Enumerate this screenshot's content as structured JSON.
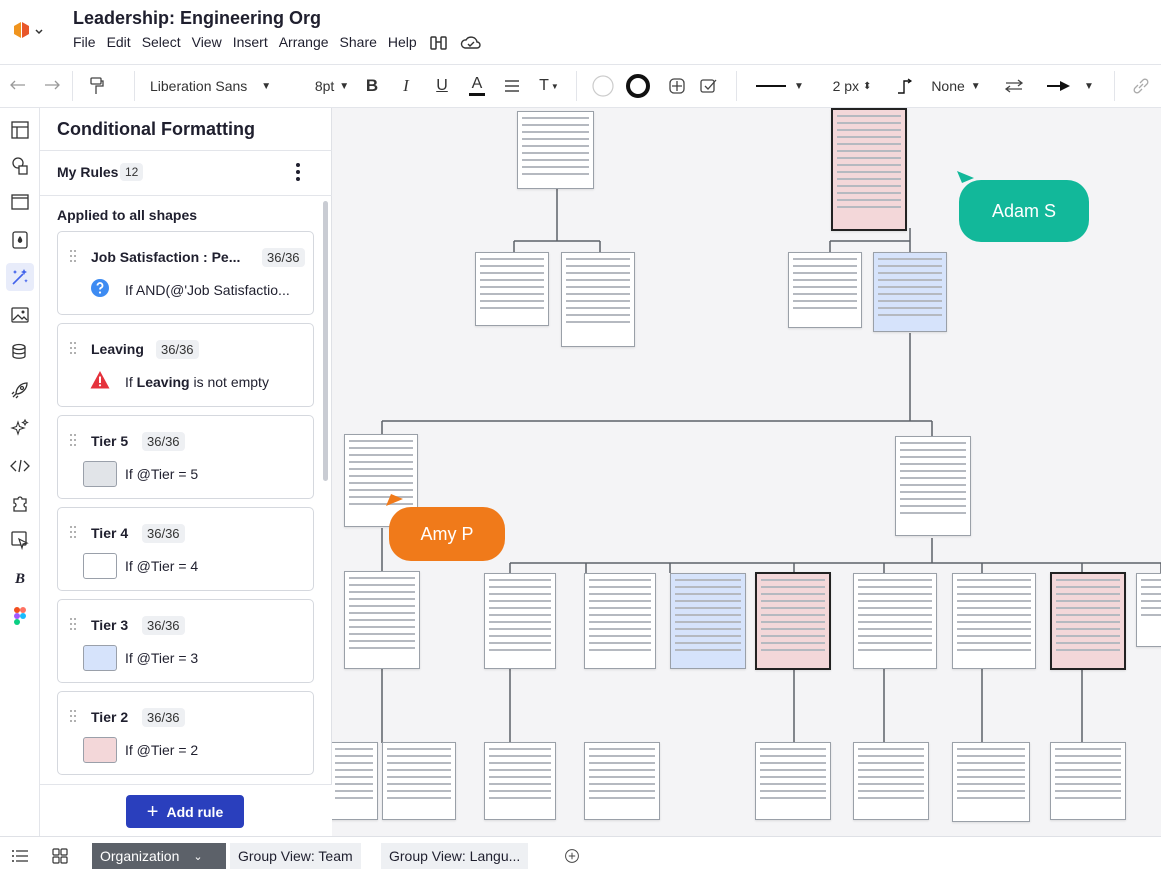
{
  "doc": {
    "title": "Leadership: Engineering Org"
  },
  "menu": [
    "File",
    "Edit",
    "Select",
    "View",
    "Insert",
    "Arrange",
    "Share",
    "Help"
  ],
  "toolbar": {
    "font": "Liberation Sans",
    "font_size": "8pt",
    "line_width": "2 px",
    "arrow_label": "None"
  },
  "panel": {
    "title": "Conditional Formatting",
    "my_rules_label": "My Rules",
    "my_rules_count": "12",
    "applied_label": "Applied to all shapes",
    "rules": [
      {
        "name": "Job Satisfaction : Pe...",
        "count": "36/36",
        "condition": "If AND(@'Job Satisfactio...",
        "icon": "question-icon",
        "swatch": ""
      },
      {
        "name": "Leaving",
        "count": "36/36",
        "condition_prefix": "If ",
        "condition_bold": "Leaving",
        "condition_suffix": " is not empty",
        "icon": "warning-icon",
        "swatch": ""
      },
      {
        "name": "Tier 5",
        "count": "36/36",
        "condition": "If @Tier = 5",
        "swatch": "#e1e4e8"
      },
      {
        "name": "Tier 4",
        "count": "36/36",
        "condition": "If @Tier = 4",
        "swatch": "#ffffff"
      },
      {
        "name": "Tier 3",
        "count": "36/36",
        "condition": "If @Tier = 3",
        "swatch": "#d6e3fb"
      },
      {
        "name": "Tier 2",
        "count": "36/36",
        "condition": "If @Tier = 2",
        "swatch": "#f3d7d9"
      }
    ],
    "add_rule_label": "Add rule"
  },
  "collaborators": [
    {
      "name": "Adam S",
      "color": "#12b89a"
    },
    {
      "name": "Amy P",
      "color": "#f07a1a"
    }
  ],
  "tabs": [
    {
      "label": "Organization",
      "active": true
    },
    {
      "label": "Group View: Team",
      "active": false
    },
    {
      "label": "Group View: Langu...",
      "active": false
    }
  ]
}
